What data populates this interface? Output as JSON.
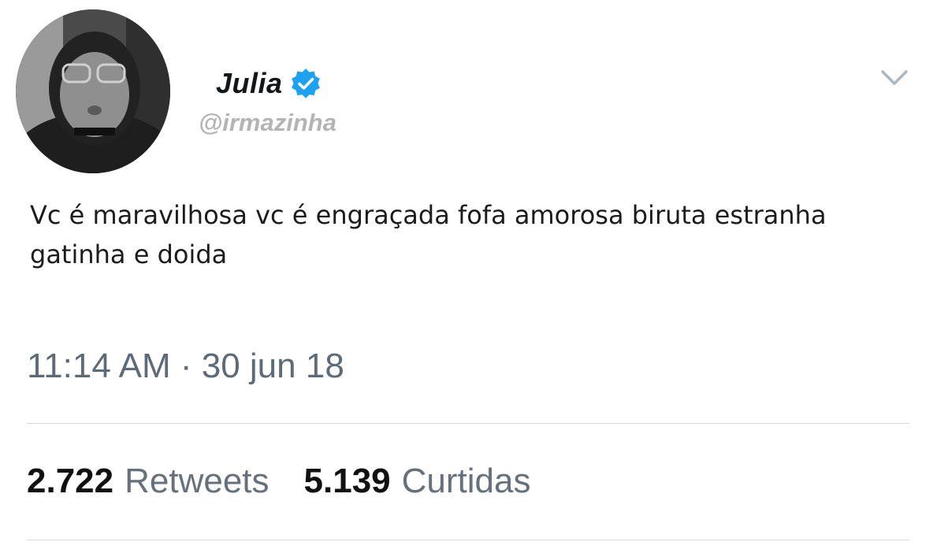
{
  "user": {
    "display_name": "Julia",
    "handle": "@irmazinha",
    "verified": true,
    "verified_color": "#1da1f2"
  },
  "tweet": {
    "text_line_1": "Vc é maravilhosa vc é engraçada fofa amorosa biruta estranha",
    "text_line_2": "gatinha e doida",
    "timestamp": "11:14 AM · 30 jun 18"
  },
  "stats": {
    "retweets_count": "2.722",
    "retweets_label": "Retweets",
    "likes_count": "5.139",
    "likes_label": "Curtidas"
  },
  "icons": {
    "verified": "verified-badge-icon",
    "menu": "chevron-down-icon"
  }
}
